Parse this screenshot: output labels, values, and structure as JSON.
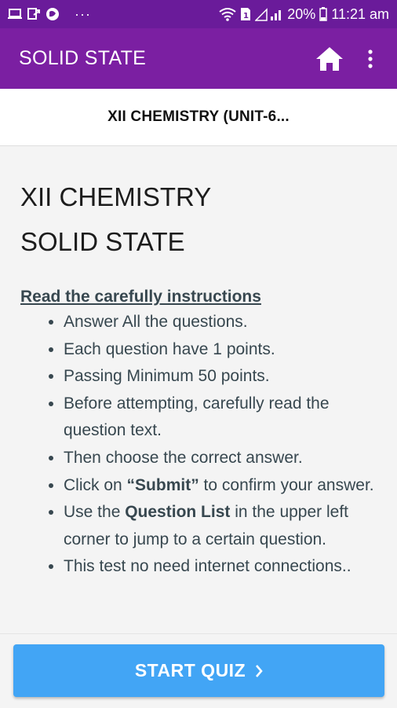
{
  "status_bar": {
    "battery_percent": "20%",
    "time": "11:21 am",
    "notification_icons": [
      "screen-icon",
      "share-icon",
      "browser-icon",
      "more-dots-icon"
    ],
    "system_icons": [
      "wifi-icon",
      "sim-icon",
      "signal-icon",
      "battery-icon"
    ]
  },
  "app_bar": {
    "title": "SOLID STATE",
    "color": "#7b1fa2"
  },
  "subheader": {
    "title": "XII CHEMISTRY (UNIT-6..."
  },
  "content": {
    "title_lines": [
      "XII CHEMISTRY",
      "SOLID STATE"
    ],
    "instructions_heading": "Read the carefully instructions",
    "items": [
      {
        "text": "Answer All the questions."
      },
      {
        "text": "Each question have 1 points."
      },
      {
        "text": "Passing Minimum 50 points."
      },
      {
        "text": "Before attempting, carefully read the question text."
      },
      {
        "text": "Then choose the correct answer."
      },
      {
        "pre": "Click on ",
        "bold": "“Submit”",
        "post": " to confirm your answer."
      },
      {
        "pre": "Use the ",
        "bold": "Question List",
        "post": " in the upper left corner to jump to a certain question."
      },
      {
        "text": "This test no need internet connections.."
      }
    ]
  },
  "footer": {
    "start_label": "START QUIZ",
    "button_color": "#42a5f5"
  }
}
